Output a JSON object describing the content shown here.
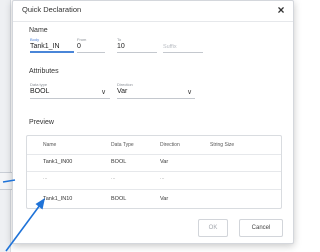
{
  "dialog": {
    "title": "Quick Declaration",
    "close_glyph": "×",
    "name_section": "Name",
    "fields": {
      "body": {
        "label": "Body",
        "value": "Tank1_IN"
      },
      "from": {
        "label": "From",
        "value": "0"
      },
      "to": {
        "label": "To",
        "value": "10"
      },
      "suffix": {
        "placeholder": "Suffix"
      }
    },
    "attributes_section": "Attributes",
    "data_type": {
      "label": "Data type",
      "value": "BOOL"
    },
    "direction": {
      "label": "Direction",
      "value": "Var"
    },
    "preview": {
      "title": "Preview",
      "columns": [
        "Name",
        "Data Type",
        "Direction",
        "String Size"
      ],
      "rows": [
        [
          "Tank1_IN00",
          "BOOL",
          "Var",
          ""
        ],
        [
          "...",
          "...",
          "...",
          ""
        ],
        [
          "Tank1_IN10",
          "BOOL",
          "Var",
          ""
        ]
      ]
    },
    "buttons": {
      "ok": "OK",
      "cancel": "Cancel"
    }
  },
  "colors": {
    "accent": "#4a86d8",
    "arrow": "#1f73d8"
  }
}
